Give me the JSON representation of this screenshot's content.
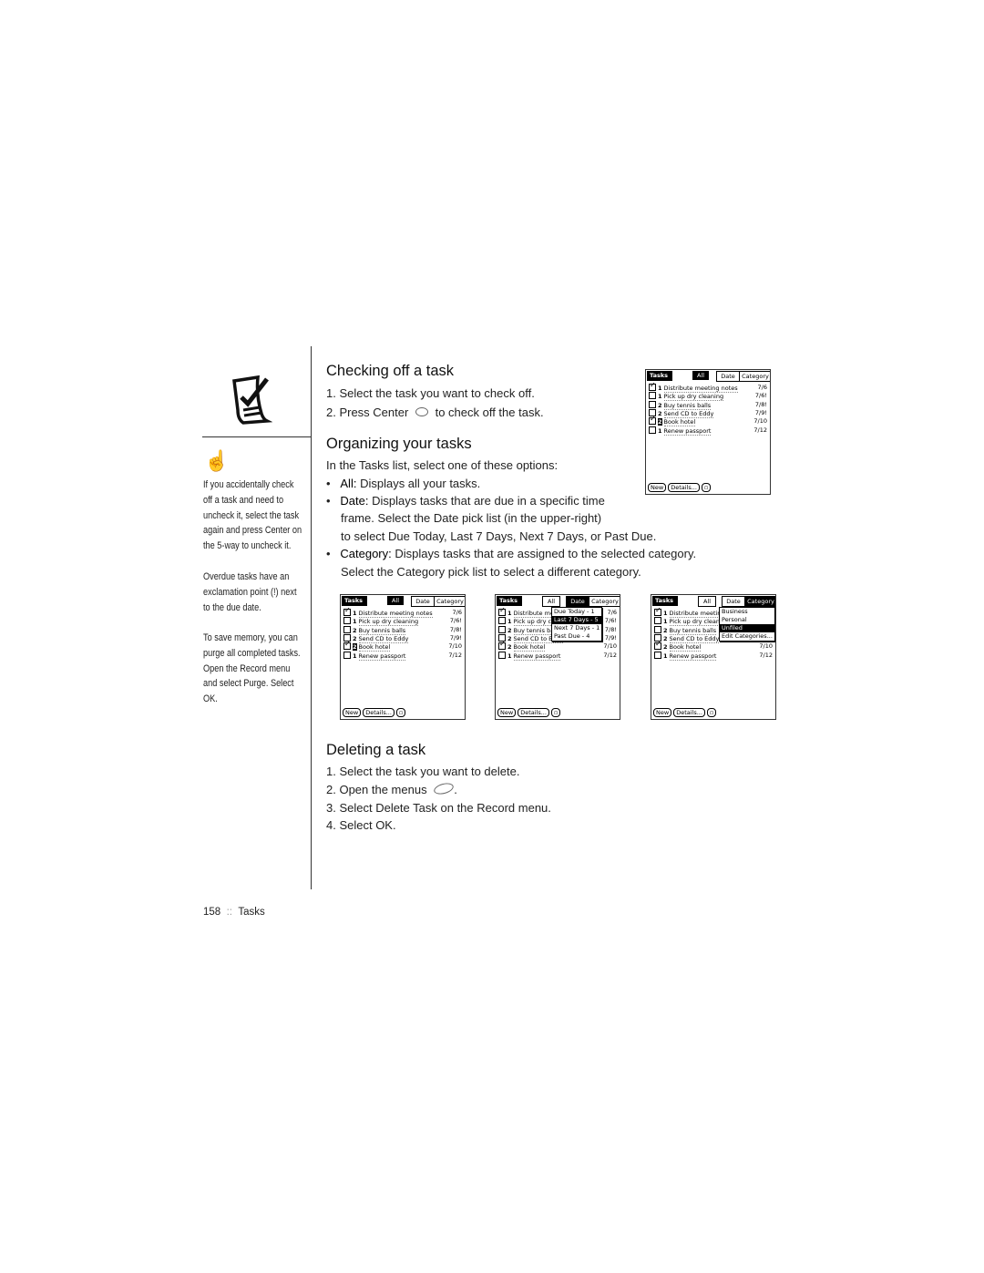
{
  "sidebar": {
    "notes": [
      "If you accidentally check off a task and need to uncheck it, select the task again and press Center on the 5-way to uncheck it.",
      "Overdue tasks have an exclamation point (!) next to the due date.",
      "To save memory, you can purge all completed tasks. Open the Record menu and select Purge. Select OK."
    ],
    "icons": [
      "task-checklist-icon",
      "tip-hand-icon"
    ]
  },
  "sections": {
    "checking": {
      "title": "Checking off a task",
      "steps": [
        "1.  Select the task you want to check off.",
        "2.  Press Center",
        "to check off the task."
      ]
    },
    "organizing": {
      "title": "Organizing your tasks",
      "intro": "In the Tasks list, select one of these options:",
      "all_label": "All:",
      "all_text": " Displays all your tasks.",
      "date_label": "Date:",
      "date_text1": " Displays tasks that are due in a specific time",
      "date_text2": "frame. Select the Date pick list (in the upper-right)",
      "date_text3": "to select Due Today, Last 7 Days, Next 7 Days, or Past Due.",
      "cat_label": "Category:",
      "cat_text1": " Displays tasks that are assigned to the selected category.",
      "cat_text2": "Select the Category pick list to select a different category."
    },
    "deleting": {
      "title": "Deleting a task",
      "steps": [
        "1.  Select the task you want to delete.",
        "2.  Open the menus",
        "3.  Select Delete Task on the Record menu.",
        "4.  Select OK."
      ]
    }
  },
  "device": {
    "title": "Tasks",
    "tabs": [
      "All",
      "Date",
      "Category"
    ],
    "buttons": [
      "New",
      "Details..."
    ],
    "tasks": [
      {
        "checked": true,
        "priority": "1",
        "name": "Distribute meeting notes",
        "date": "7/6"
      },
      {
        "checked": false,
        "priority": "1",
        "name": "Pick up dry cleaning",
        "date": "7/6!"
      },
      {
        "checked": false,
        "priority": "2",
        "name": "Buy tennis balls",
        "date": "7/8!"
      },
      {
        "checked": false,
        "priority": "2",
        "name": "Send CD to Eddy",
        "date": "7/9!"
      },
      {
        "checked": true,
        "priority": "2",
        "name": "Book hotel",
        "date": "7/10"
      },
      {
        "checked": false,
        "priority": "1",
        "name": "Renew passport",
        "date": "7/12"
      }
    ],
    "date_options": [
      "Due Today - 1",
      "Last 7 Days - 5",
      "Next 7 Days - 1",
      "Past Due - 4"
    ],
    "date_selected": 1,
    "category_options": [
      "Business",
      "Personal",
      "Unfiled",
      "Edit Categories..."
    ],
    "category_selected": 2
  },
  "footer": {
    "page": "158",
    "sep": "::",
    "chapter": "Tasks"
  }
}
